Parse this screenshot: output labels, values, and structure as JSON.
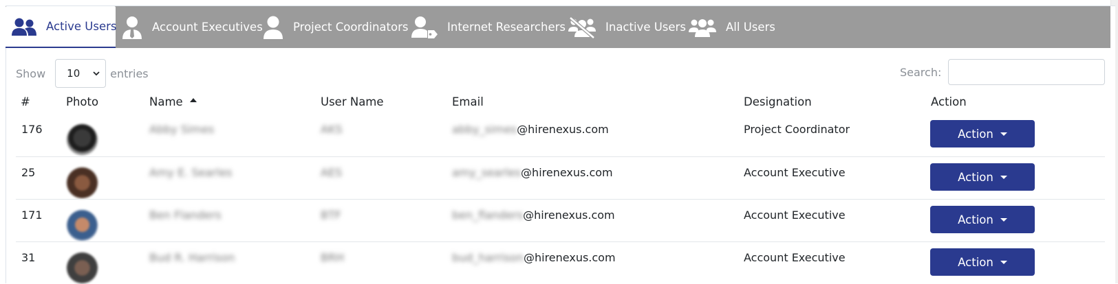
{
  "tabs": [
    {
      "label": "Active Users",
      "icon": "users-icon",
      "active": true
    },
    {
      "label": "Account Executives",
      "icon": "user-tie-icon",
      "active": false
    },
    {
      "label": "Project Coordinators",
      "icon": "user-icon",
      "active": false
    },
    {
      "label": "Internet Researchers",
      "icon": "user-tag-icon",
      "active": false
    },
    {
      "label": "Inactive Users",
      "icon": "users-slash-icon",
      "active": false
    },
    {
      "label": "All Users",
      "icon": "user-group-icon",
      "active": false
    }
  ],
  "length": {
    "show_label": "Show",
    "value": "10",
    "entries_label": "entries"
  },
  "search": {
    "label": "Search:",
    "value": ""
  },
  "table": {
    "headers": {
      "num": "#",
      "photo": "Photo",
      "name": "Name",
      "username": "User Name",
      "email": "Email",
      "designation": "Designation",
      "action": "Action"
    },
    "rows": [
      {
        "num": "176",
        "name": "Abby Simes",
        "username": "AKS",
        "email_local": "abby_simes",
        "email_domain": "@hirenexus.com",
        "designation": "Project Coordinator",
        "action": "Action"
      },
      {
        "num": "25",
        "name": "Amy E. Searles",
        "username": "AES",
        "email_local": "amy_searles",
        "email_domain": "@hirenexus.com",
        "designation": "Account Executive",
        "action": "Action"
      },
      {
        "num": "171",
        "name": "Ben Flanders",
        "username": "BTF",
        "email_local": "ben_flanders",
        "email_domain": "@hirenexus.com",
        "designation": "Account Executive",
        "action": "Action"
      },
      {
        "num": "31",
        "name": "Bud R. Harrison",
        "username": "BRH",
        "email_local": "bud_harrison",
        "email_domain": "@hirenexus.com",
        "designation": "Account Executive",
        "action": "Action"
      }
    ]
  },
  "colors": {
    "accent": "#2a3a8f",
    "tabbar": "#9b9b9b",
    "muted_text": "#8a8f96"
  }
}
